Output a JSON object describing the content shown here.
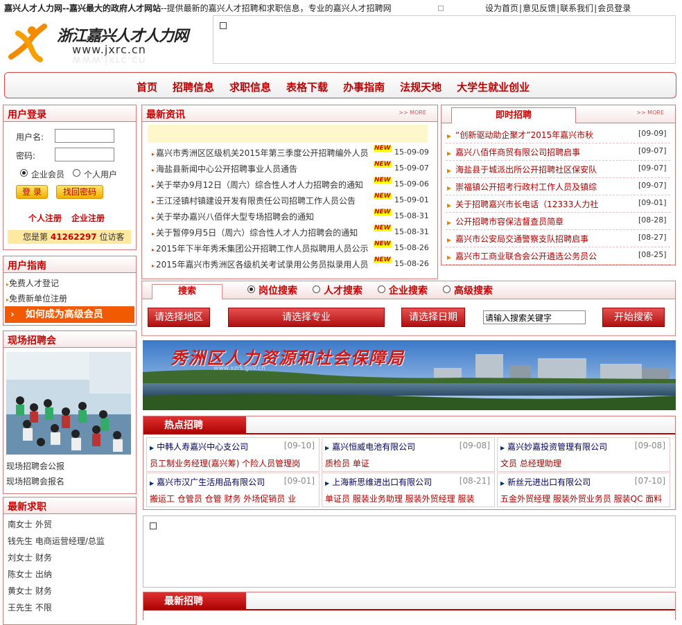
{
  "top": {
    "slogan_bold": "嘉兴人才人力网--嘉兴最大的政府人才网站",
    "slogan_rest": "--提供最新的嘉兴人才招聘和求职信息，专业的嘉兴人才招聘网",
    "links": [
      "设为首页",
      "意见反馈",
      "联系我们",
      "会员登录"
    ]
  },
  "logo": {
    "name": "浙江嘉兴人才人力网",
    "url": "www.jxrc.cn"
  },
  "nav": [
    "首页",
    "招聘信息",
    "求职信息",
    "表格下载",
    "办事指南",
    "法规天地",
    "大学生就业创业"
  ],
  "login": {
    "title": "用户登录",
    "username_label": "用户名:",
    "password_label": "密码:",
    "radio_company": "企业会员",
    "radio_personal": "个人用户",
    "login_btn": "登 录",
    "recover_btn": "找回密码",
    "reg_personal": "个人注册",
    "reg_company": "企业注册",
    "visitor_prefix": "您是第",
    "visitor_count": "41262297",
    "visitor_suffix": "位访客"
  },
  "guide": {
    "title": "用户指南",
    "items": [
      "免费人才登记",
      "免费新单位注册"
    ],
    "highlight": "如何成为高级会员"
  },
  "fair": {
    "title": "现场招聘会",
    "links": [
      "现场招聘会公报",
      "现场招聘会报名"
    ]
  },
  "seekers": {
    "title": "最新求职",
    "items": [
      "南女士  外贸",
      "钱先生  电商运营经理/总监",
      "刘女士  财务",
      "陈女士  出纳",
      "黄女士  财务",
      "王先生  不限"
    ]
  },
  "news": {
    "title": "最新资讯",
    "more": ">> MORE",
    "new_tag": "NEW",
    "items": [
      {
        "title": "嘉兴市秀洲区区级机关2015年第三季度公开招聘编外人员",
        "date": "15-09-09"
      },
      {
        "title": "海盐县新闻中心公开招聘事业人员通告",
        "date": "15-09-07"
      },
      {
        "title": "关于举办9月12日（周六）综合性人才人力招聘会的通知",
        "date": "15-09-06"
      },
      {
        "title": "王江泾镇村镇建设开发有限责任公司招聘工作人员公告",
        "date": "15-09-01"
      },
      {
        "title": "关于举办嘉兴八佰伴大型专场招聘会的通知",
        "date": "15-08-31"
      },
      {
        "title": "关于暂停9月5日（周六）综合性人才人力招聘会的通知",
        "date": "15-08-31"
      },
      {
        "title": "2015年下半年秀禾集团公开招聘工作人员拟聘用人员公示",
        "date": "15-08-26"
      },
      {
        "title": "2015年嘉兴市秀洲区各级机关考试录用公务员拟录用人员",
        "date": "15-08-26"
      }
    ]
  },
  "instant": {
    "title": "即时招聘",
    "more": ">> MORE",
    "items": [
      {
        "title": "“创新驱动助企聚才”2015年嘉兴市秋",
        "date": "[09-09]"
      },
      {
        "title": "嘉兴八佰伴商贸有限公司招聘启事",
        "date": "[09-07]"
      },
      {
        "title": "海盐县于城派出所公开招聘社区保安队",
        "date": "[09-07]"
      },
      {
        "title": "崇福镇公开招考行政村工作人员及镇综",
        "date": "[09-07]"
      },
      {
        "title": "关于招聘嘉兴市长电话（12333人力社",
        "date": "[09-01]"
      },
      {
        "title": "公开招聘市容保洁督查员简章",
        "date": "[08-28]"
      },
      {
        "title": "嘉兴市公安局交通警察支队招聘启事",
        "date": "[08-27]"
      },
      {
        "title": "嘉兴市工商业联合会公开遴选公务员公",
        "date": "[08-25]"
      }
    ]
  },
  "search": {
    "tab": "搜索",
    "options": [
      "岗位搜索",
      "人才搜索",
      "企业搜索",
      "高级搜索"
    ],
    "selected": "岗位搜索",
    "area": "请选择地区",
    "major": "请选择专业",
    "date": "请选择日期",
    "keyword_value": "请输入搜索关键字",
    "go": "开始搜索"
  },
  "bureau_banner": {
    "title": "秀洲区人力资源和社会保障局",
    "site": "www.xzrs.gov.cn"
  },
  "hot": {
    "title": "热点招聘",
    "cells": [
      {
        "company": "中韩人寿嘉兴中心支公司",
        "date": "[09-10]",
        "jobs": "员工制业务经理(嘉兴筹)    个险人员管理岗"
      },
      {
        "company": "嘉兴恒威电池有限公司",
        "date": "[09-08]",
        "jobs": "质检员  单证"
      },
      {
        "company": "嘉兴妙嘉投资管理有限公司",
        "date": "[09-08]",
        "jobs": "文员  总经理助理"
      },
      {
        "company": "嘉兴市汉广生活用品有限公司",
        "date": "[09-01]",
        "jobs": "搬运工  仓管员  仓管  财务  外场促销员  业"
      },
      {
        "company": "上海新思维进出口有限公司",
        "date": "[08-21]",
        "jobs": "单证员  服装业务助理  服装外贸经理  服装"
      },
      {
        "company": "新丝元进出口有限公司",
        "date": "[07-10]",
        "jobs": "五金外贸经理  服装外贸业务员  服装QC  面料"
      }
    ]
  },
  "latest": {
    "title": "最新招聘"
  },
  "colors": {
    "brand_red": "#c00000",
    "border": "#dd7777",
    "accent_yellow": "#ffe36a"
  }
}
